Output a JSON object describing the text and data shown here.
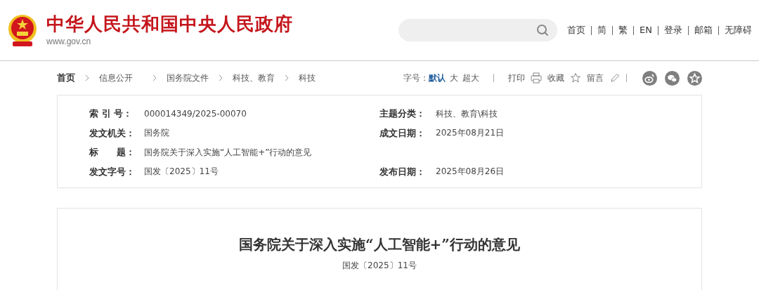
{
  "header": {
    "site_title": "中华人民共和国中央人民政府",
    "site_url": "www.gov.cn",
    "nav": [
      "首页",
      "简",
      "繁",
      "EN",
      "登录",
      "邮箱",
      "无障碍"
    ]
  },
  "breadcrumb": [
    "首页",
    "信息公开",
    "国务院文件",
    "科技、教育",
    "科技"
  ],
  "toolbar": {
    "font_size_label": "字号：",
    "font_sizes": [
      {
        "label": "默认",
        "selected": true
      },
      {
        "label": "大",
        "selected": false
      },
      {
        "label": "超大",
        "selected": false
      }
    ],
    "actions": [
      {
        "label": "打印",
        "kind": "print"
      },
      {
        "label": "收藏",
        "kind": "star"
      },
      {
        "label": "留言",
        "kind": "pencil"
      }
    ],
    "share": [
      {
        "kind": "weibo"
      },
      {
        "kind": "wechat"
      },
      {
        "kind": "favorite"
      }
    ]
  },
  "meta": [
    {
      "label": "索 引 号：",
      "value": "000014349/2025-00070",
      "label_2": "主题分类：",
      "value_2": "科技、教育\\科技"
    },
    {
      "label": "发文机关：",
      "value": "国务院",
      "label_2": "成文日期：",
      "value_2": "2025年08月21日"
    },
    {
      "label": "标　　题：",
      "value": "国务院关于深入实施“人工智能+”行动的意见"
    },
    {
      "label": "发文字号：",
      "value": "国发〔2025〕11号",
      "label_2": "发布日期：",
      "value_2": "2025年08月26日"
    }
  ],
  "document": {
    "title": "国务院关于深入实施“人工智能+”行动的意见",
    "number": "国发〔2025〕11号"
  }
}
